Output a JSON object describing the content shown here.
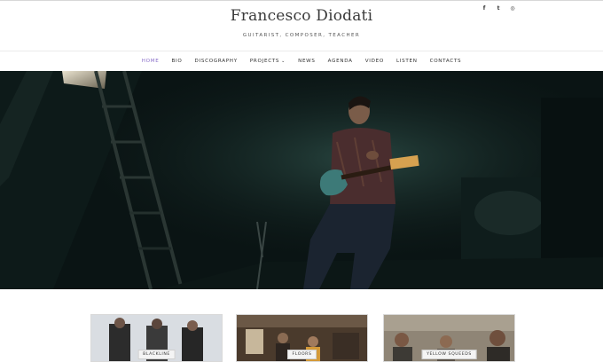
{
  "site": {
    "title": "Francesco Diodati",
    "tagline": "GUITARIST, COMPOSER, TEACHER"
  },
  "social": [
    {
      "icon": "facebook-icon",
      "glyph": "f"
    },
    {
      "icon": "twitter-icon",
      "glyph": "t"
    },
    {
      "icon": "instagram-icon",
      "glyph": "◎"
    }
  ],
  "nav": {
    "items": [
      {
        "label": "HOME",
        "active": true
      },
      {
        "label": "BIO"
      },
      {
        "label": "DISCOGRAPHY"
      },
      {
        "label": "PROJECTS"
      },
      {
        "label": "NEWS"
      },
      {
        "label": "AGENDA"
      },
      {
        "label": "VIDEO"
      },
      {
        "label": "LISTEN"
      },
      {
        "label": "CONTACTS"
      }
    ],
    "projects_caret": "⌄",
    "active_color": "#8a6fc9"
  },
  "projects": [
    {
      "label": "BLACKLINE"
    },
    {
      "label": "FLOORS"
    },
    {
      "label": "YELLOW SQUEEDS"
    }
  ]
}
